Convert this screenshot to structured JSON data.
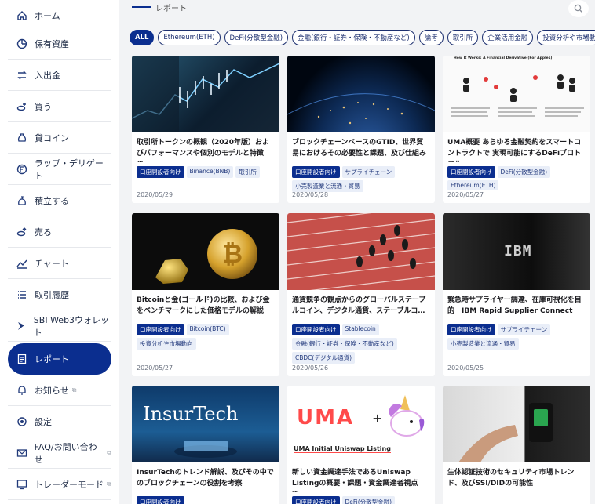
{
  "sidebar": {
    "items": [
      {
        "label": "ホーム",
        "icon": "home-icon"
      },
      {
        "label": "保有資産",
        "icon": "pie-chart-icon"
      },
      {
        "label": "入出金",
        "icon": "transfer-icon"
      },
      {
        "label": "買う",
        "icon": "buy-coins-icon"
      },
      {
        "label": "貸コイン",
        "icon": "lend-bag-icon"
      },
      {
        "label": "ラップ・デリゲート",
        "icon": "wrap-icon"
      },
      {
        "label": "積立する",
        "icon": "savings-icon"
      },
      {
        "label": "売る",
        "icon": "sell-coins-icon"
      },
      {
        "label": "チャート",
        "icon": "chart-line-icon"
      },
      {
        "label": "取引履歴",
        "icon": "history-list-icon"
      },
      {
        "label": "SBI Web3ウォレット",
        "icon": "wallet-logo-icon"
      },
      {
        "label": "レポート",
        "icon": "report-icon",
        "active": true
      },
      {
        "label": "お知らせ",
        "icon": "bell-icon",
        "external": true
      },
      {
        "label": "設定",
        "icon": "gear-icon"
      },
      {
        "label": "FAQ/お問い合わせ",
        "icon": "mail-icon",
        "external": true
      },
      {
        "label": "トレーダーモード",
        "icon": "trader-mode-icon",
        "external": true
      }
    ]
  },
  "header": {
    "title": "レポート",
    "search_icon": "search-icon"
  },
  "filters": [
    {
      "label": "ALL",
      "active": true
    },
    {
      "label": "Ethereum(ETH)"
    },
    {
      "label": "DeFi(分散型金融)"
    },
    {
      "label": "金融(銀行・証券・保険・不動産など)"
    },
    {
      "label": "論考"
    },
    {
      "label": "取引所"
    },
    {
      "label": "企業活用金融"
    },
    {
      "label": "投資分析や市場動"
    }
  ],
  "cards": [
    {
      "title": "取引所トークンの概観（2020年版）およびパフォーマンスや個別のモデルと特徴の…",
      "tags": [
        "口座開設者向け",
        "Binance(BNB)",
        "取引所"
      ],
      "date": "2020/05/29"
    },
    {
      "title": "ブロックチェーンベースのGTID、世界貿易におけるその必要性と課題、及び仕組み",
      "tags": [
        "口座開設者向け",
        "サプライチェーン",
        "小売製造業と流通・貿易"
      ],
      "date": "2020/05/28"
    },
    {
      "title": "UMA概要 あらゆる金融契約をスマートコントラクトで 実現可能にするDeFiプロトコル",
      "tags": [
        "口座開設者向け",
        "DeFi(分散型金融)",
        "Ethereum(ETH)"
      ],
      "date": "2020/05/27",
      "thumb_heading": "How It Works: A Financial Derivative (For Apples)"
    },
    {
      "title": "Bitcoinと金(ゴールド)の比較、および金をベンチマークにした価格モデルの解説",
      "tags": [
        "口座開設者向け",
        "Bitcoin(BTC)",
        "投資分析や市場動向"
      ],
      "date": "2020/05/27"
    },
    {
      "title": "通貨競争の観点からのグローバルステーブルコイン、デジタル通貨、ステーブルコ…",
      "tags": [
        "口座開設者向け",
        "Stablecoin",
        "金融(銀行・証券・保険・不動産など)",
        "CBDC(デジタル通貨)"
      ],
      "date": "2020/05/26"
    },
    {
      "title": "緊急時サプライヤー調達、在庫可視化を目的　IBM Rapid Supplier Connect",
      "tags": [
        "口座開設者向け",
        "サプライチェーン",
        "小売製造業と流通・貿易"
      ],
      "date": "2020/05/25",
      "thumb_logo": "IBM"
    },
    {
      "title": "InsurTechのトレンド解説、及びその中でのブロックチェーンの役割を考察",
      "tags": [
        "口座開設者向け"
      ],
      "date": "",
      "thumb_heading": "InsurTech"
    },
    {
      "title": "新しい資金調達手法であるUniswap Listingの概要・課題・資金調達者視点で…",
      "tags": [
        "口座開設者向け",
        "DeFi(分散型金融)"
      ],
      "date": "",
      "thumb_logo": "UMA",
      "thumb_caption": "UMA Initial Uniswap Listing"
    },
    {
      "title": "生体認証技術のセキュリティ市場トレンド、及びSSI/DIDの可能性",
      "tags": [],
      "date": ""
    }
  ],
  "colors": {
    "accent": "#0b2e8f",
    "tag_bg": "#e9eef8",
    "page_bg": "#f2f3f5"
  }
}
